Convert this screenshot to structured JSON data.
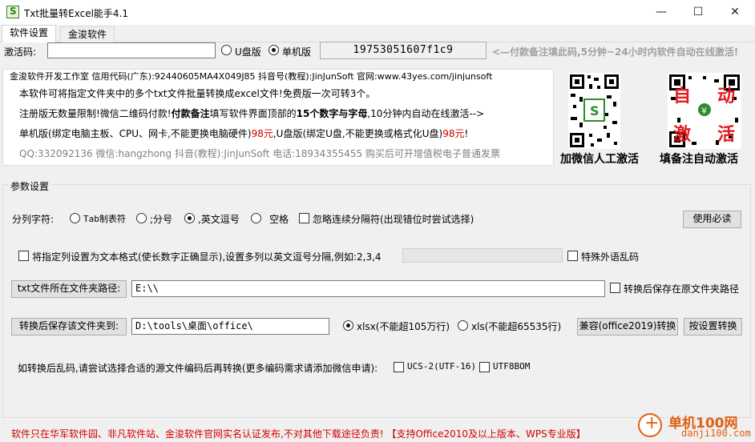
{
  "window": {
    "title": "Txt批量转Excel能手4.1",
    "minimize_glyph": "—",
    "maximize_glyph": "☐",
    "close_glyph": "✕"
  },
  "tabs": [
    {
      "label": "软件设置",
      "active": true
    },
    {
      "label": "金浚软件",
      "active": false
    }
  ],
  "activation": {
    "label": "激活码:",
    "code_value": "",
    "usb_label": "U盘版",
    "single_label": "单机版",
    "machine_code": "19753051607f1c9",
    "notice": "<—付款备注填此码,5分钟~24小时内软件自动在线激活!"
  },
  "info": {
    "header": "金浚软件开发工作室  信用代码(广东):92440605MA4X049J85  抖音号(教程):JinJunSoft  官网:www.43yes.com/jinjunsoft",
    "line1": "本软件可将指定文件夹中的多个txt文件批量转换成excel文件!免费版一次可转3个。",
    "line2_a": "注册版无数量限制!微信二维码付款!",
    "line2_b": "付款备注",
    "line2_c": "填写软件界面顶部的",
    "line2_d": "15个数字与字母",
    "line2_e": ",10分钟内自动在线激活-->",
    "line3_a": "单机版(绑定电脑主板、CPU、网卡,不能更换电脑硬件)",
    "line3_b": "98元",
    "line3_c": ",U盘版(绑定U盘,不能更换或格式化U盘)",
    "line3_d": "98元",
    "line3_e": "!",
    "line4": "QQ:332092136 微信:hangzhong 抖音(教程):JinJunSoft 电话:18934355455 购买后可开增值税电子普通发票"
  },
  "qr": {
    "wechat_caption": "加微信人工激活",
    "pay_caption": "填备注自动激活",
    "pay_overlay_chars": [
      "自",
      "动",
      "激",
      "活"
    ]
  },
  "params": {
    "group_label": "参数设置",
    "delimiter_label": "分列字符:",
    "opt_tab": "Tab制表符",
    "opt_semicolon": ";分号",
    "opt_comma": ",英文逗号",
    "opt_space": "空格",
    "ignore_label": "忽略连续分隔符(出现错位时尝试选择)",
    "help_button": "使用必读",
    "text_format_label": "将指定列设置为文本格式(使长数字正确显示),设置多列以英文逗号分隔,例如:2,3,4",
    "text_format_value": "",
    "foreign_label": "特殊外语乱码",
    "src_button": "txt文件所在文件夹路径:",
    "src_value": "E:\\\\",
    "save_original_label": "转换后保存在原文件夹路径",
    "dst_button": "转换后保存该文件夹到:",
    "dst_value": "D:\\tools\\桌面\\office\\",
    "xlsx_label": "xlsx(不能超105万行)",
    "xls_label": "xls(不能超65535行)",
    "compat_button": "兼容(office2019)转换",
    "convert_button": "按设置转换",
    "encoding_hint": "如转换后乱码,请尝试选择合适的源文件编码后再转换(更多编码需求请添加微信申请):",
    "enc_ucs2": "UCS-2(UTF-16)",
    "enc_utf8bom": "UTF8BOM"
  },
  "footer": {
    "text": "软件只在华军软件园、非凡软件站、金浚软件官网实名认证发布,不对其他下载途径负责! 【支持Office2010及以上版本、WPS专业版】"
  },
  "watermark": {
    "line1": "单机100网",
    "line2": "danji100.com"
  },
  "colors": {
    "red": "#d40000",
    "qr_green": "#2e8b2e",
    "qr_red": "#e31b1b"
  }
}
